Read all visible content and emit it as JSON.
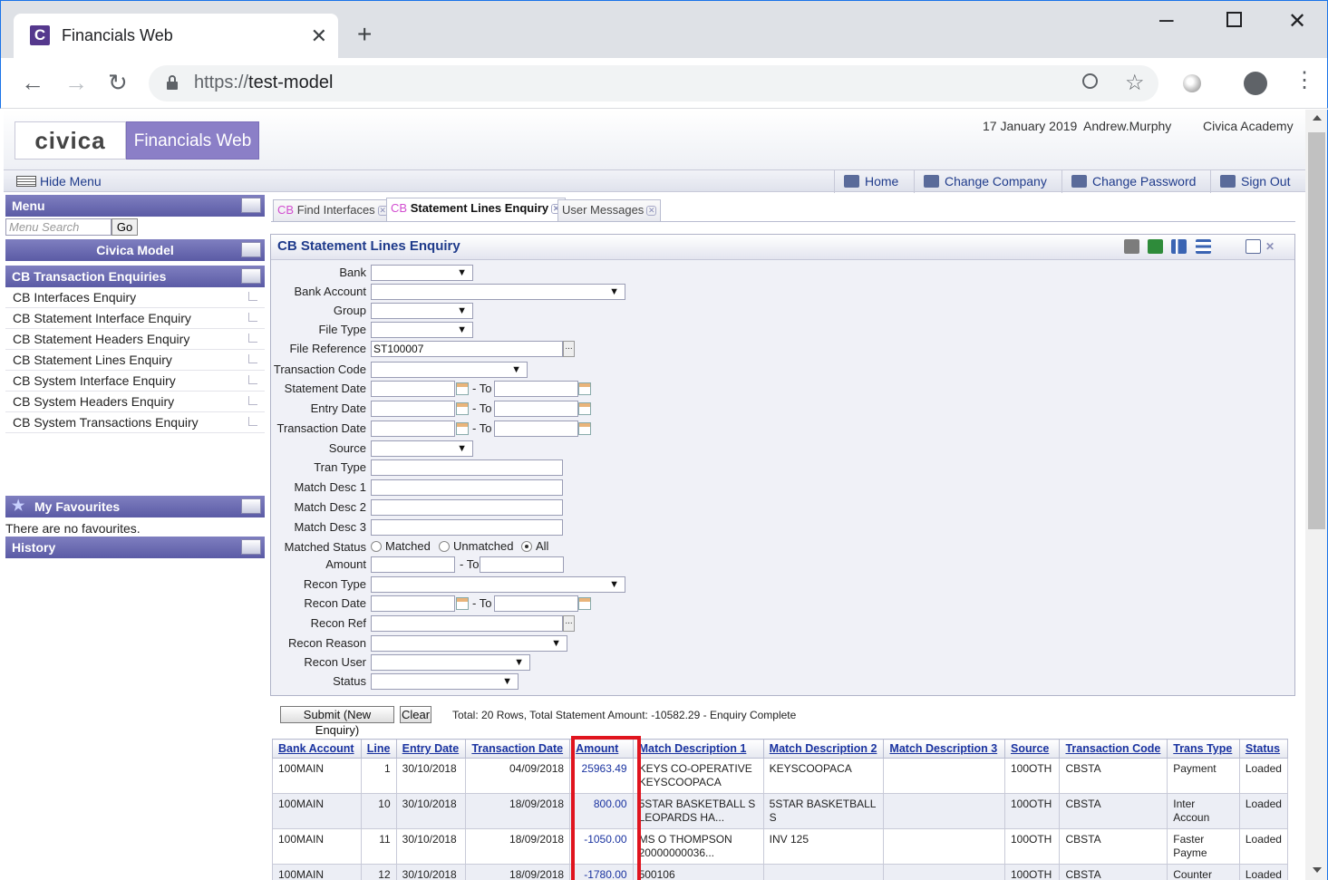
{
  "browser": {
    "tab_title": "Financials Web",
    "tab_favicon_letter": "C",
    "url_scheme": "https://",
    "url_host": "test-model"
  },
  "header": {
    "logo_civica": "civica",
    "logo_product": "Financials Web",
    "date": "17 January 2019",
    "user": "Andrew.Murphy",
    "company": "Civica Academy"
  },
  "menubar": {
    "hide_menu": "Hide Menu",
    "home": "Home",
    "change_company": "Change Company",
    "change_password": "Change Password",
    "sign_out": "Sign Out"
  },
  "sidebar": {
    "menu_title": "Menu",
    "search_placeholder": "Menu Search",
    "go": "Go",
    "section_model": "Civica Model",
    "section_enquiries": "CB Transaction Enquiries",
    "items": [
      "CB Interfaces Enquiry",
      "CB Statement Interface Enquiry",
      "CB Statement Headers Enquiry",
      "CB Statement Lines Enquiry",
      "CB System Interface Enquiry",
      "CB System Headers Enquiry",
      "CB System Transactions Enquiry"
    ],
    "favourites_title": "My Favourites",
    "no_favourites": "There are no favourites.",
    "history_title": "History"
  },
  "tabs": [
    {
      "prefix": "CB",
      "label": "Find Interfaces"
    },
    {
      "prefix": "CB",
      "label": "Statement Lines Enquiry"
    },
    {
      "prefix": "",
      "label": "User Messages"
    }
  ],
  "panel": {
    "title": "CB Statement Lines Enquiry",
    "labels": {
      "bank": "Bank",
      "bank_account": "Bank Account",
      "group": "Group",
      "file_type": "File Type",
      "file_reference": "File Reference",
      "transaction_code": "Transaction Code",
      "statement_date": "Statement Date",
      "entry_date": "Entry Date",
      "transaction_date": "Transaction Date",
      "source": "Source",
      "tran_type": "Tran Type",
      "match_desc_1": "Match Desc 1",
      "match_desc_2": "Match Desc 2",
      "match_desc_3": "Match Desc 3",
      "matched_status": "Matched Status",
      "amount": "Amount",
      "recon_type": "Recon Type",
      "recon_date": "Recon Date",
      "recon_ref": "Recon Ref",
      "recon_reason": "Recon Reason",
      "recon_user": "Recon User",
      "status": "Status",
      "to": "- To"
    },
    "file_reference_value": "ST100007",
    "ellipsis": "...",
    "radio_matched": "Matched",
    "radio_unmatched": "Unmatched",
    "radio_all": "All",
    "submit": "Submit (New Enquiry)",
    "clear": "Clear",
    "totals": "Total: 20 Rows, Total Statement Amount: -10582.29 - Enquiry Complete"
  },
  "grid": {
    "columns": [
      "Bank Account",
      "Line",
      "Entry Date",
      "Transaction Date",
      "Amount",
      "Match Description 1",
      "Match Description 2",
      "Match Description 3",
      "Source",
      "Transaction Code",
      "Trans Type",
      "Status"
    ],
    "rows": [
      [
        "100MAIN",
        "1",
        "30/10/2018",
        "04/09/2018",
        "25963.49",
        "KEYS CO-OPERATIVE KEYSCOOPACA",
        "KEYSCOOPACA",
        "",
        "100OTH",
        "CBSTA",
        "Payment",
        "Loaded"
      ],
      [
        "100MAIN",
        "10",
        "30/10/2018",
        "18/09/2018",
        "800.00",
        "5STAR BASKETBALL S LEOPARDS HA...",
        "5STAR BASKETBALL S",
        "",
        "100OTH",
        "CBSTA",
        "Inter Accoun",
        "Loaded"
      ],
      [
        "100MAIN",
        "11",
        "30/10/2018",
        "18/09/2018",
        "-1050.00",
        "MS O THOMPSON 20000000036...",
        "INV 125",
        "",
        "100OTH",
        "CBSTA",
        "Faster Payme",
        "Loaded"
      ],
      [
        "100MAIN",
        "12",
        "30/10/2018",
        "18/09/2018",
        "-1780.00",
        "500106",
        "",
        "",
        "100OTH",
        "CBSTA",
        "Counter",
        "Loaded"
      ]
    ]
  }
}
